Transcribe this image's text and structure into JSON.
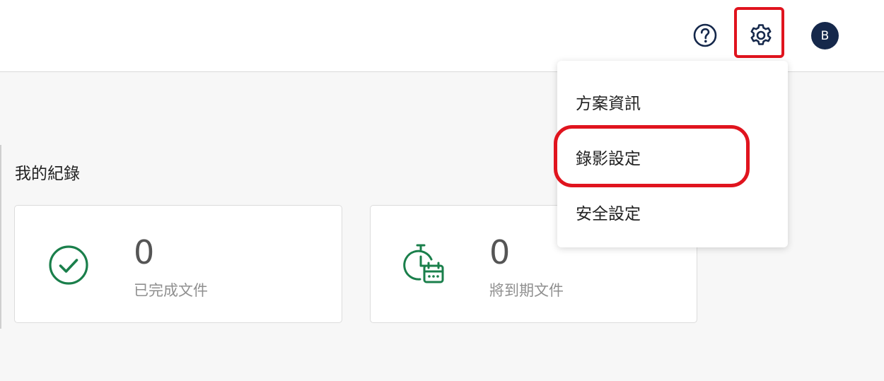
{
  "header": {
    "help_icon": "help-circle-icon",
    "settings_icon": "gear-icon",
    "avatar_initial": "B"
  },
  "settings_menu": {
    "items": [
      {
        "label": "方案資訊"
      },
      {
        "label": "錄影設定"
      },
      {
        "label": "安全設定"
      }
    ]
  },
  "records": {
    "title": "我的紀錄",
    "cards": [
      {
        "count": "0",
        "label": "已完成文件",
        "icon": "check-circle-icon"
      },
      {
        "count": "0",
        "label": "將到期文件",
        "icon": "timer-calendar-icon"
      }
    ]
  },
  "colors": {
    "accent_green": "#1a7f4b",
    "highlight_red": "#e0141e",
    "avatar_navy": "#15284b"
  }
}
